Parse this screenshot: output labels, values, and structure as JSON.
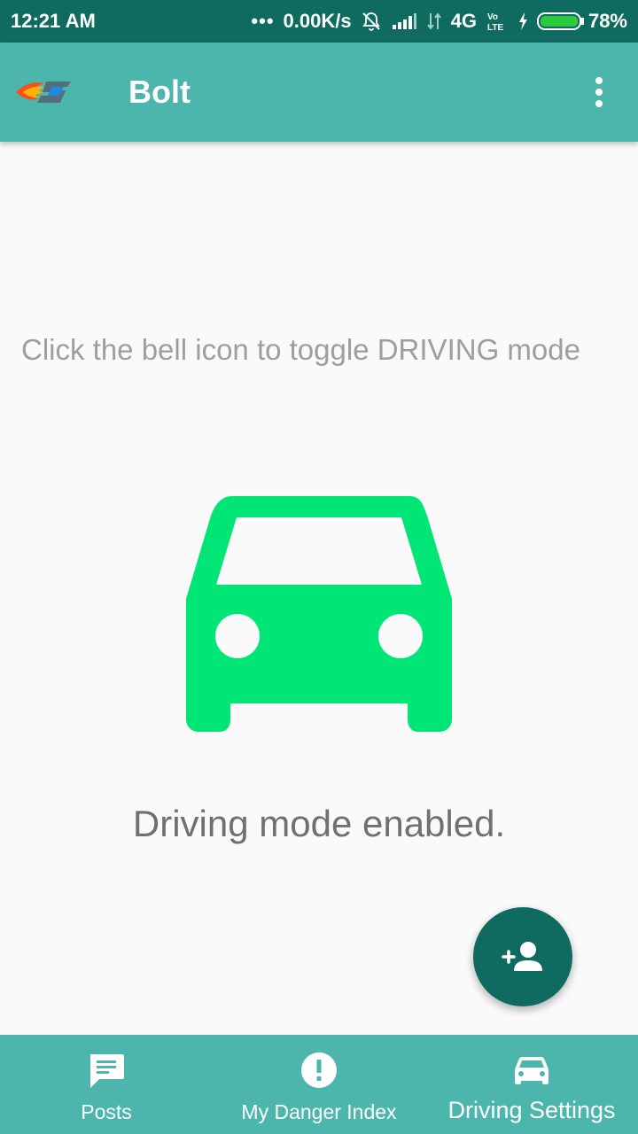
{
  "status_bar": {
    "time": "12:21 AM",
    "net_speed": "0.00K/s",
    "network": "4G",
    "battery": "78%"
  },
  "app_bar": {
    "title": "Bolt"
  },
  "main": {
    "instruction": "Click the bell icon to toggle DRIVING mode",
    "status": "Driving mode enabled."
  },
  "bottom_nav": {
    "items": [
      {
        "label": "Posts",
        "icon": "chat-icon"
      },
      {
        "label": "My Danger Index",
        "icon": "alert-icon"
      },
      {
        "label": "Driving Settings",
        "icon": "car-icon"
      }
    ]
  },
  "colors": {
    "status_bar": "#0f6b5f",
    "primary": "#4db6ac",
    "fab": "#0f6b5f",
    "car": "#00e676"
  }
}
